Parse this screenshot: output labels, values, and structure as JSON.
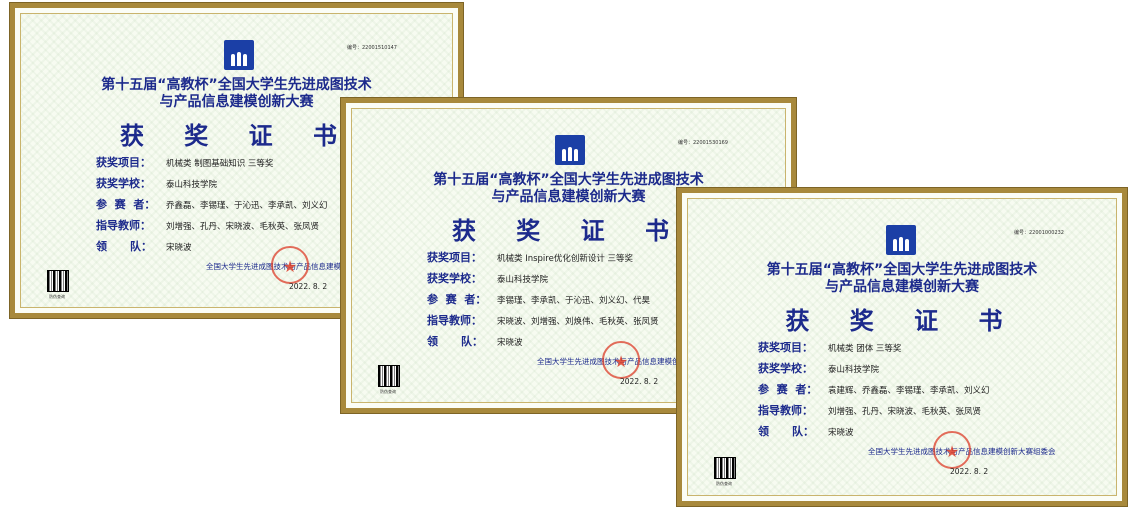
{
  "certificates": [
    {
      "serial": "编号：22001510147",
      "title_line1": "第十五届“高教杯”全国大学生先进成图技术",
      "title_line2": "与产品信息建模创新大赛",
      "heading": "获 奖 证 书",
      "rows": [
        {
          "label": "获奖项目：",
          "value": "机械类 制图基础知识 三等奖"
        },
        {
          "label": "获奖学校：",
          "value": "泰山科技学院"
        },
        {
          "label": "参  赛  者：",
          "value": "乔鑫磊、李锡瑾、于沁迅、李承凯、刘义幻"
        },
        {
          "label": "指导教师：",
          "value": "刘增强、孔丹、宋晓波、毛秋英、张凤贤"
        },
        {
          "label": "领      队：",
          "value": "宋晓波"
        }
      ],
      "organizer": "全国大学生先进成图技术与产品信息建模创",
      "date": "2022. 8. 2",
      "qr_label": "防伪查询"
    },
    {
      "serial": "编号：22001530169",
      "title_line1": "第十五届“高教杯”全国大学生先进成图技术",
      "title_line2": "与产品信息建模创新大赛",
      "heading": "获 奖 证 书",
      "rows": [
        {
          "label": "获奖项目：",
          "value": "机械类 Inspire优化创新设计 三等奖"
        },
        {
          "label": "获奖学校：",
          "value": "泰山科技学院"
        },
        {
          "label": "参  赛  者：",
          "value": "李锡瑾、李承凯、于沁迅、刘义幻、代昊"
        },
        {
          "label": "指导教师：",
          "value": "宋晓波、刘增强、刘焕伟、毛秋英、张凤贤"
        },
        {
          "label": "领      队：",
          "value": "宋晓波"
        }
      ],
      "organizer": "全国大学生先进成图技术与产品信息建模创",
      "date": "2022. 8. 2",
      "qr_label": "防伪查询"
    },
    {
      "serial": "编号：22001000232",
      "title_line1": "第十五届“高教杯”全国大学生先进成图技术",
      "title_line2": "与产品信息建模创新大赛",
      "heading": "获 奖 证 书",
      "rows": [
        {
          "label": "获奖项目：",
          "value": "机械类 团体 三等奖"
        },
        {
          "label": "获奖学校：",
          "value": "泰山科技学院"
        },
        {
          "label": "参  赛  者：",
          "value": "袁建辉、乔鑫磊、李锡瑾、李承凯、刘义幻"
        },
        {
          "label": "指导教师：",
          "value": "刘增强、孔丹、宋晓波、毛秋英、张凤贤"
        },
        {
          "label": "领      队：",
          "value": "宋晓波"
        }
      ],
      "organizer": "全国大学生先进成图技术与产品信息建模创新大赛组委会",
      "date": "2022. 8. 2",
      "qr_label": "防伪查询"
    }
  ]
}
